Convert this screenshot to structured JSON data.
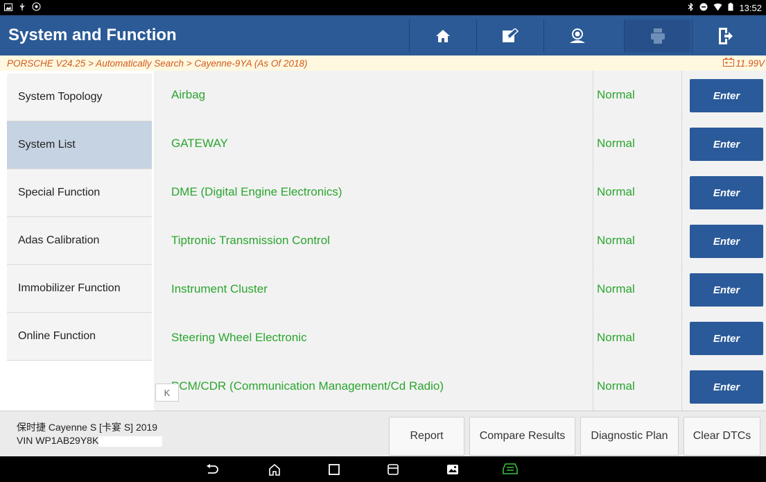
{
  "statusbar": {
    "time": "13:52"
  },
  "header": {
    "title": "System and Function"
  },
  "toolbar": {
    "icons": [
      "home-icon",
      "edit-icon",
      "user-feedback-icon",
      "print-icon",
      "exit-icon"
    ]
  },
  "breadcrumb": {
    "path": "PORSCHE V24.25 > Automatically Search > Cayenne-9YA (As Of 2018)",
    "voltage": "11.99V"
  },
  "sidebar": {
    "items": [
      {
        "label": "System Topology"
      },
      {
        "label": "System List"
      },
      {
        "label": "Special Function"
      },
      {
        "label": "Adas Calibration"
      },
      {
        "label": "Immobilizer Function"
      },
      {
        "label": "Online Function"
      }
    ],
    "selected": "System List"
  },
  "systems": [
    {
      "name": "Airbag",
      "status": "Normal",
      "action": "Enter"
    },
    {
      "name": "GATEWAY",
      "status": "Normal",
      "action": "Enter"
    },
    {
      "name": "DME (Digital Engine Electronics)",
      "status": "Normal",
      "action": "Enter"
    },
    {
      "name": "Tiptronic Transmission Control",
      "status": "Normal",
      "action": "Enter"
    },
    {
      "name": "Instrument Cluster",
      "status": "Normal",
      "action": "Enter"
    },
    {
      "name": "Steering Wheel Electronic",
      "status": "Normal",
      "action": "Enter"
    },
    {
      "name": "PCM/CDR (Communication Management/Cd Radio)",
      "status": "Normal",
      "action": "Enter"
    }
  ],
  "collapse_label": "K",
  "vehicle": {
    "model": "保时捷 Cayenne S [卡宴 S] 2019",
    "vin": "VIN WP1AB29Y8K"
  },
  "footer_buttons": {
    "report": "Report",
    "compare": "Compare Results",
    "plan": "Diagnostic Plan",
    "clear": "Clear DTCs"
  },
  "colors": {
    "header_blue": "#2b5a96",
    "status_green": "#2aa52e",
    "breadcrumb_orange": "#d15a1a"
  }
}
